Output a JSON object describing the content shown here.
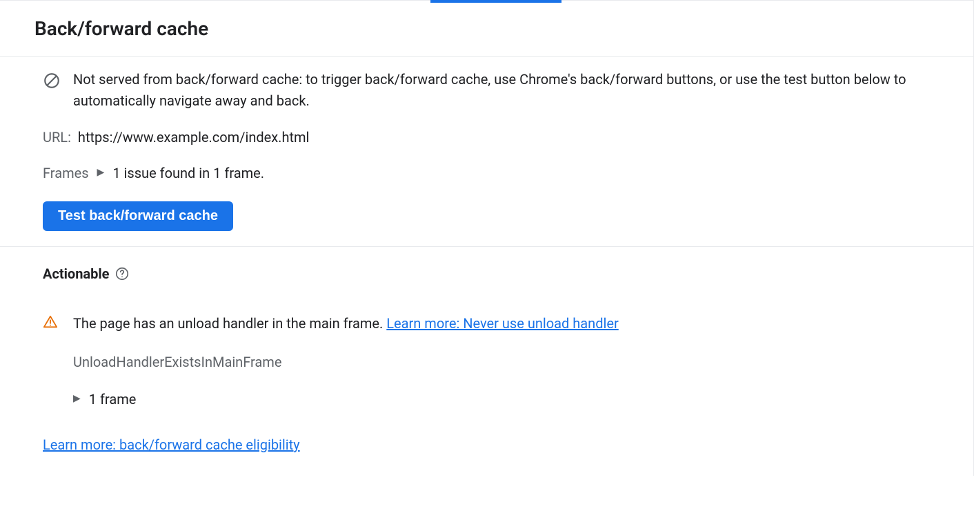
{
  "header": {
    "title": "Back/forward cache"
  },
  "status": {
    "message": "Not served from back/forward cache: to trigger back/forward cache, use Chrome's back/forward buttons, or use the test button below to automatically navigate away and back."
  },
  "url": {
    "label": "URL:",
    "value": "https://www.example.com/index.html"
  },
  "frames": {
    "label": "Frames",
    "summary": "1 issue found in 1 frame."
  },
  "test_button": {
    "label": "Test back/forward cache"
  },
  "actionable": {
    "heading": "Actionable",
    "issues": [
      {
        "message": "The page has an unload handler in the main frame.",
        "learn_more_label": "Learn more: Never use unload handler",
        "reason_id": "UnloadHandlerExistsInMainFrame",
        "frame_count_label": "1 frame"
      }
    ],
    "bottom_link": "Learn more: back/forward cache eligibility"
  }
}
